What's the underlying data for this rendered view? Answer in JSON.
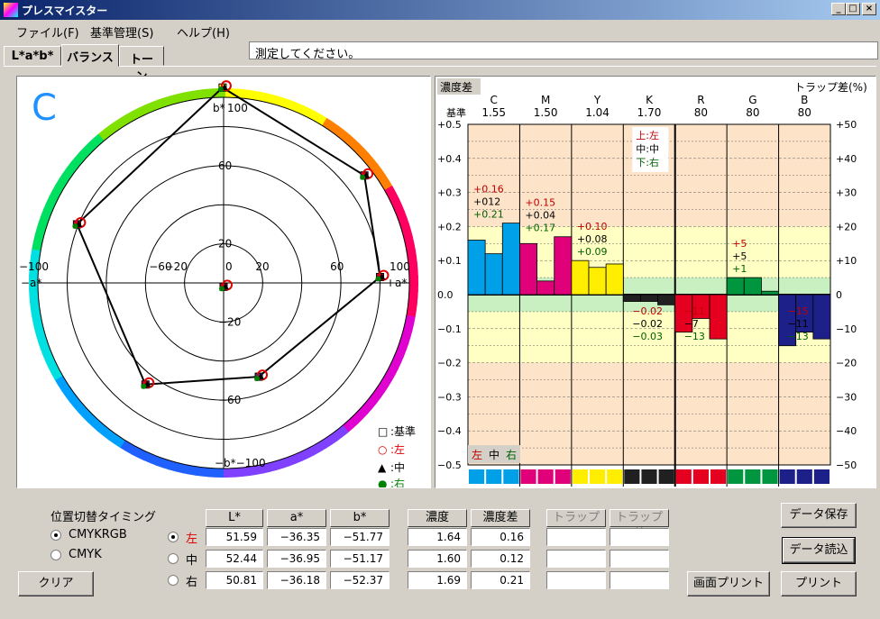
{
  "window": {
    "title": "プレスマイスター",
    "min": "_",
    "max": "□",
    "close": "×"
  },
  "menu": [
    "ファイル(F)",
    "基準管理(S)",
    "ヘルプ(H)"
  ],
  "status_message": "測定してください。",
  "tabs": [
    {
      "label": "L*a*b*"
    },
    {
      "label": "バランス"
    },
    {
      "label": "トーン"
    }
  ],
  "active_tab": 1,
  "polar": {
    "channel": "C",
    "tick_labels": {
      "top": "100",
      "bottom": "−b*−100",
      "left": "−100",
      "left2": "−a*",
      "right": "100",
      "right2": "+a*",
      "top_b": "b*",
      "rings": [
        "20",
        "60",
        "−20",
        "−60",
        "20",
        "0",
        "−20",
        "20",
        "60"
      ]
    },
    "legend": [
      {
        "symbol": "□",
        "label": ":基準"
      },
      {
        "symbol": "○",
        "label": ":左"
      },
      {
        "symbol": "▲",
        "label": ":中"
      },
      {
        "symbol": "●",
        "label": ":右"
      }
    ],
    "base_points": [
      [
        -0.5,
        100
      ],
      [
        72,
        55
      ],
      [
        80,
        3
      ],
      [
        18,
        -48
      ],
      [
        -40,
        -52
      ],
      [
        -75,
        30
      ],
      [
        0,
        -2
      ]
    ],
    "colors": {
      "left": "#e00000",
      "center": "#000000",
      "right": "#008000",
      "base_fill": "#ff0"
    }
  },
  "chart_data": {
    "type": "bar",
    "title": "濃度差",
    "right_title": "トラップ差(%)",
    "baseline_label": "基準",
    "categories": [
      "C",
      "M",
      "Y",
      "K",
      "R",
      "G",
      "B"
    ],
    "baselines": [
      "1.55",
      "1.50",
      "1.04",
      "1.70",
      "80",
      "80",
      "80"
    ],
    "left_axis": {
      "ylim": [
        -0.5,
        0.5
      ],
      "ticks": [
        "+0.5",
        "+0.4",
        "+0.3",
        "+0.2",
        "+0.1",
        "0.0",
        "−0.1",
        "−0.2",
        "−0.3",
        "−0.4",
        "−0.5"
      ]
    },
    "right_axis": {
      "ylim": [
        -50,
        50
      ],
      "ticks": [
        "+50",
        "+40",
        "+30",
        "+20",
        "+10",
        "0",
        "−10",
        "−20",
        "−30",
        "−40",
        "−50"
      ]
    },
    "series": [
      {
        "name": "左",
        "values": [
          0.16,
          0.15,
          0.1,
          -0.02,
          -11,
          5,
          -15
        ],
        "labels": [
          "+0.16",
          "+0.15",
          "+0.10",
          "−0.02",
          "−11",
          "+5",
          "−15"
        ]
      },
      {
        "name": "中",
        "values": [
          0.12,
          0.04,
          0.08,
          -0.02,
          -7,
          5,
          -11
        ],
        "labels": [
          "+012",
          "+0.04",
          "+0.08",
          "−0.02",
          "−7",
          "+5",
          "−11"
        ]
      },
      {
        "name": "右",
        "values": [
          0.21,
          0.17,
          0.09,
          -0.03,
          -13,
          1,
          -13
        ],
        "labels": [
          "+0.21",
          "+0.17",
          "+0.09",
          "−0.03",
          "−13",
          "+1",
          "−13"
        ]
      }
    ],
    "bar_colors": [
      "#00a0e8",
      "#e0007a",
      "#ffee00",
      "#202020",
      "#e60020",
      "#009640",
      "#1d2088"
    ],
    "legend_box": [
      "上:左",
      "中:中",
      "下:右"
    ],
    "bottom_legend": [
      "左",
      "中",
      "右"
    ]
  },
  "controls": {
    "timing_title": "位置切替タイミング",
    "timing_options": [
      "CMYKRGB",
      "CMYK"
    ],
    "timing_selected": 0,
    "clear": "クリア",
    "row_selected": 0,
    "columns": {
      "L": "L*",
      "a": "a*",
      "b": "b*",
      "density": "濃度",
      "density_diff": "濃度差",
      "trap": "トラップ",
      "trap_diff": "トラップ差"
    },
    "rows": [
      {
        "label": "左",
        "L": "51.59",
        "a": "−36.35",
        "b": "−51.77",
        "density": "1.64",
        "density_diff": "0.16",
        "trap": "",
        "trap_diff": ""
      },
      {
        "label": "中",
        "L": "52.44",
        "a": "−36.95",
        "b": "−51.17",
        "density": "1.60",
        "density_diff": "0.12",
        "trap": "",
        "trap_diff": ""
      },
      {
        "label": "右",
        "L": "50.81",
        "a": "−36.18",
        "b": "−52.37",
        "density": "1.69",
        "density_diff": "0.21",
        "trap": "",
        "trap_diff": ""
      }
    ],
    "buttons": {
      "save": "データ保存",
      "load": "データ読込",
      "screen_print": "画面プリント",
      "print": "プリント"
    }
  }
}
